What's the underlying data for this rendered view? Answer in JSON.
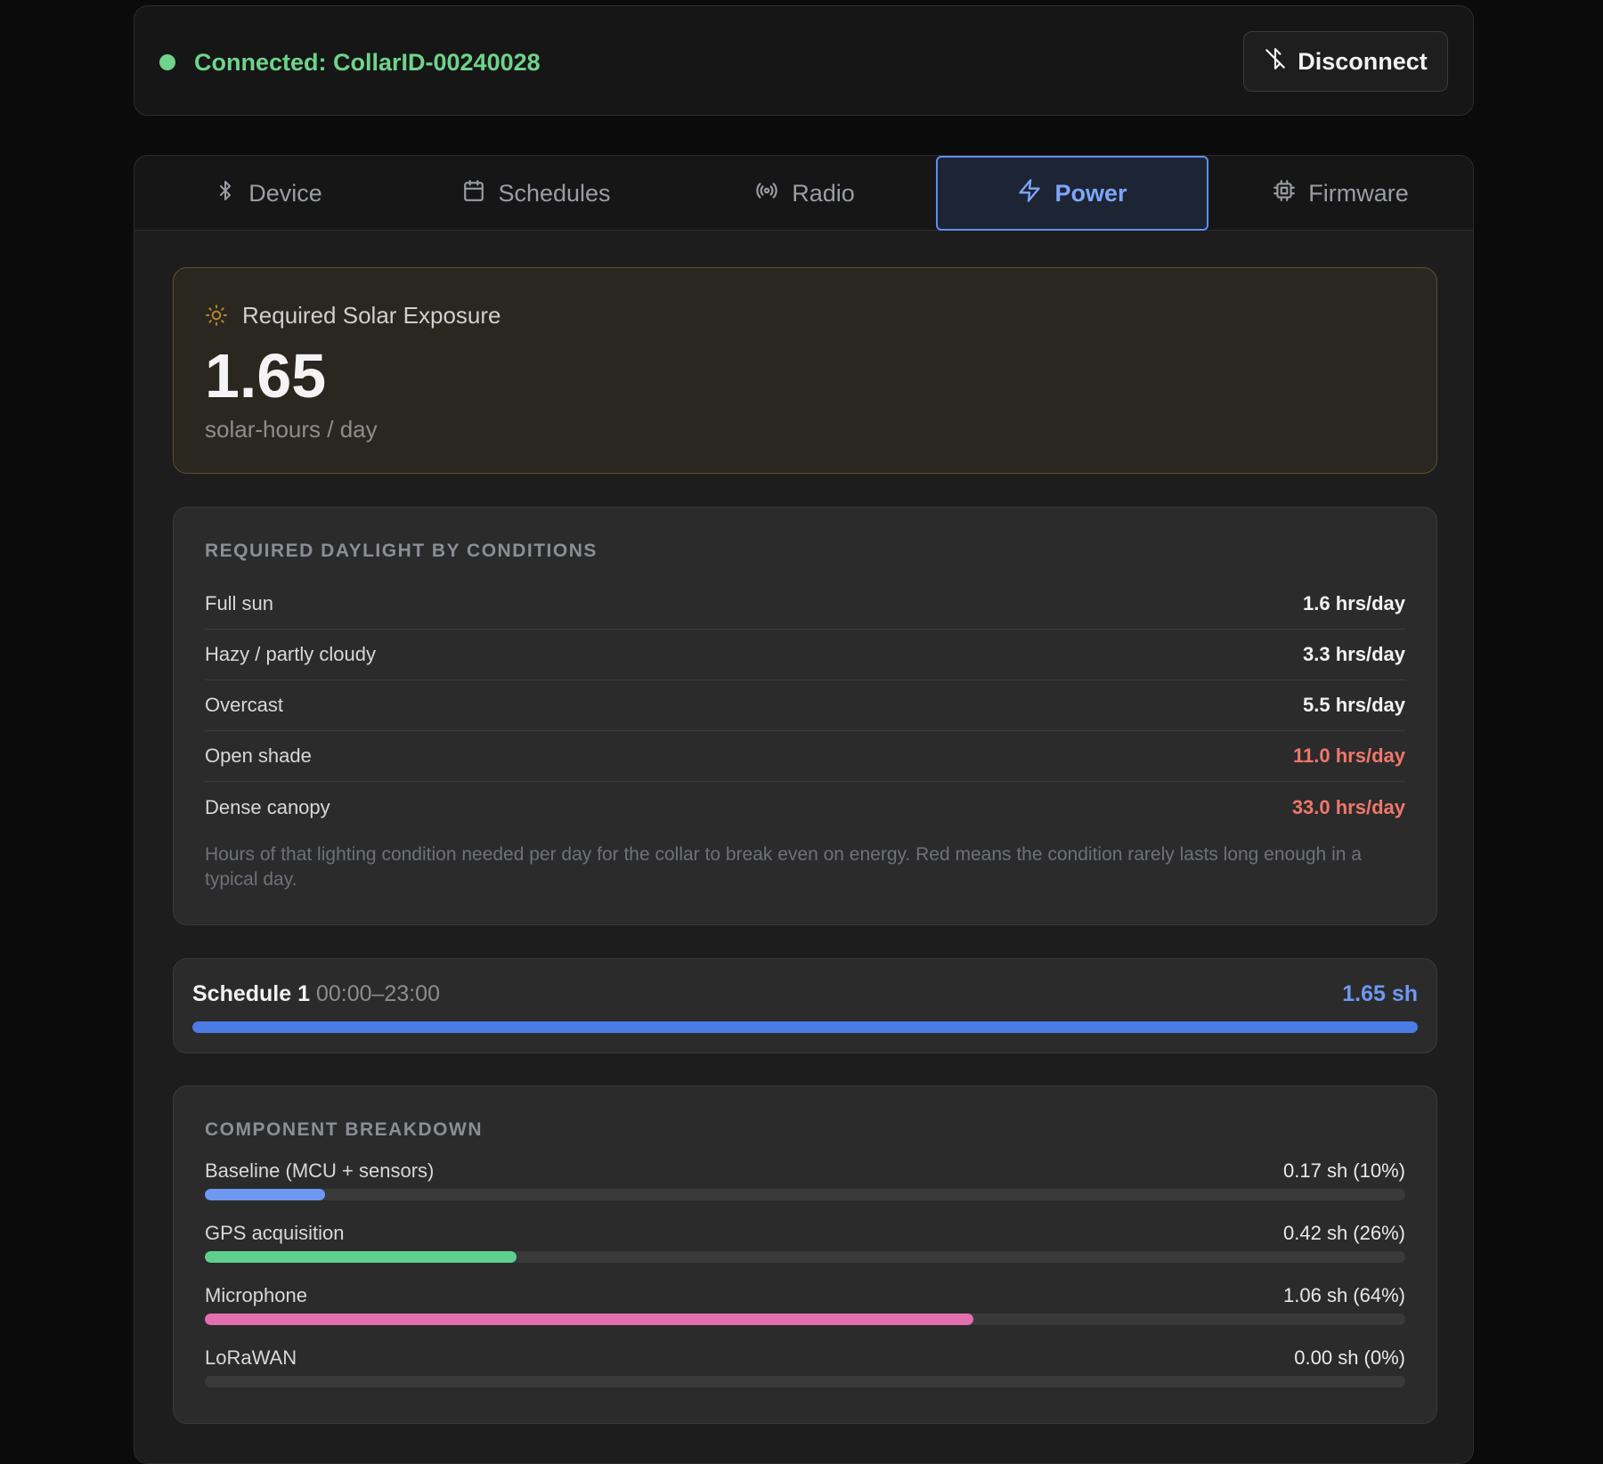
{
  "connection": {
    "status_text": "Connected: CollarID-00240028",
    "status_color": "#6fd38c",
    "disconnect_label": "Disconnect",
    "disconnect_icon": "bluetooth-off-icon"
  },
  "tabs": [
    {
      "label": "Device",
      "icon": "bluetooth-icon",
      "active": false
    },
    {
      "label": "Schedules",
      "icon": "calendar-icon",
      "active": false
    },
    {
      "label": "Radio",
      "icon": "radio-broadcast-icon",
      "active": false
    },
    {
      "label": "Power",
      "icon": "lightning-icon",
      "active": true
    },
    {
      "label": "Firmware",
      "icon": "chip-icon",
      "active": false
    }
  ],
  "solar": {
    "label": "Required Solar Exposure",
    "icon": "sun-icon",
    "value": "1.65",
    "unit": "solar-hours / day"
  },
  "conditions": {
    "title": "Required Daylight by Conditions",
    "rows": [
      {
        "name": "Full sun",
        "value": "1.6 hrs/day",
        "warn": false
      },
      {
        "name": "Hazy / partly cloudy",
        "value": "3.3 hrs/day",
        "warn": false
      },
      {
        "name": "Overcast",
        "value": "5.5 hrs/day",
        "warn": false
      },
      {
        "name": "Open shade",
        "value": "11.0 hrs/day",
        "warn": true
      },
      {
        "name": "Dense canopy",
        "value": "33.0 hrs/day",
        "warn": true
      }
    ],
    "note": "Hours of that lighting condition needed per day for the collar to break even on energy. Red means the condition rarely lasts long enough in a typical day."
  },
  "schedule": {
    "name": "Schedule 1",
    "time": "00:00–23:00",
    "value": "1.65 sh",
    "progress": 1.0
  },
  "breakdown": {
    "title": "Component Breakdown",
    "items": [
      {
        "name": "Baseline (MCU + sensors)",
        "value": "0.17 sh (10%)",
        "fraction": 0.1,
        "color": "#6e98f2"
      },
      {
        "name": "GPS acquisition",
        "value": "0.42 sh (26%)",
        "fraction": 0.26,
        "color": "#5fcf8d"
      },
      {
        "name": "Microphone",
        "value": "1.06 sh (64%)",
        "fraction": 0.64,
        "color": "#e36fae"
      },
      {
        "name": "LoRaWAN",
        "value": "0.00 sh (0%)",
        "fraction": 0.0,
        "color": "#6e98f2"
      }
    ]
  }
}
